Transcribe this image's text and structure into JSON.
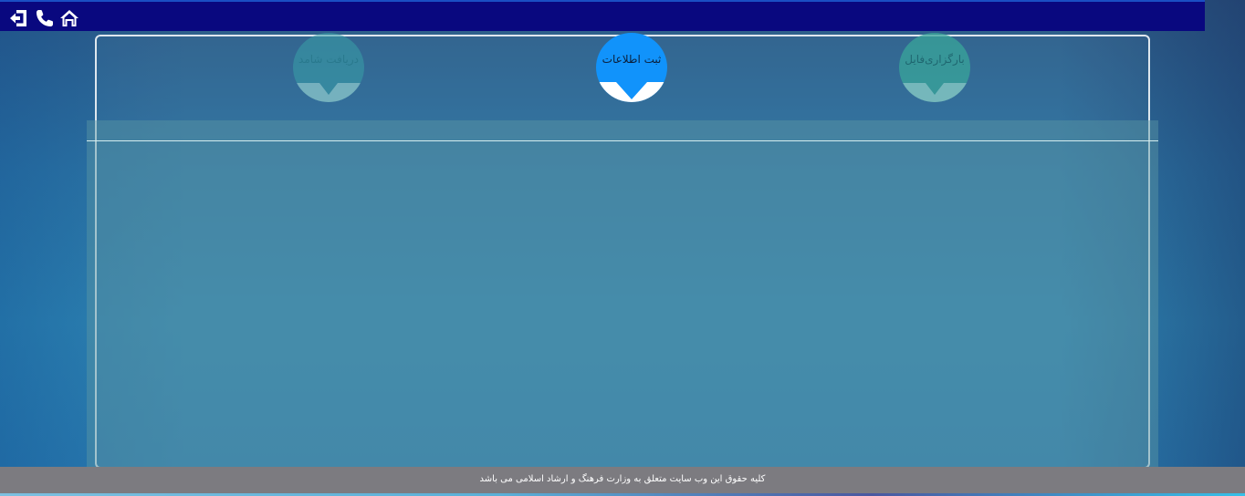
{
  "topbar": {
    "icons": [
      "logout-icon",
      "phone-icon",
      "home-icon"
    ]
  },
  "steps": [
    {
      "label": "دریافت شامد",
      "state": "inactive",
      "color": "#39a0a8"
    },
    {
      "label": "ثبت اطلاعات",
      "state": "active",
      "color": "#1193fb"
    },
    {
      "label": "بارگزاری‌فایل",
      "state": "inactive",
      "color": "#3aa59a"
    }
  ],
  "footer": {
    "text": "کلیه حقوق این وب سایت متعلق به وزارت فرهنگ و ارشاد اسلامی می باشد"
  },
  "colors": {
    "topbar": "#09087f",
    "footer": "#7c7b80",
    "active_step": "#1193fb"
  }
}
